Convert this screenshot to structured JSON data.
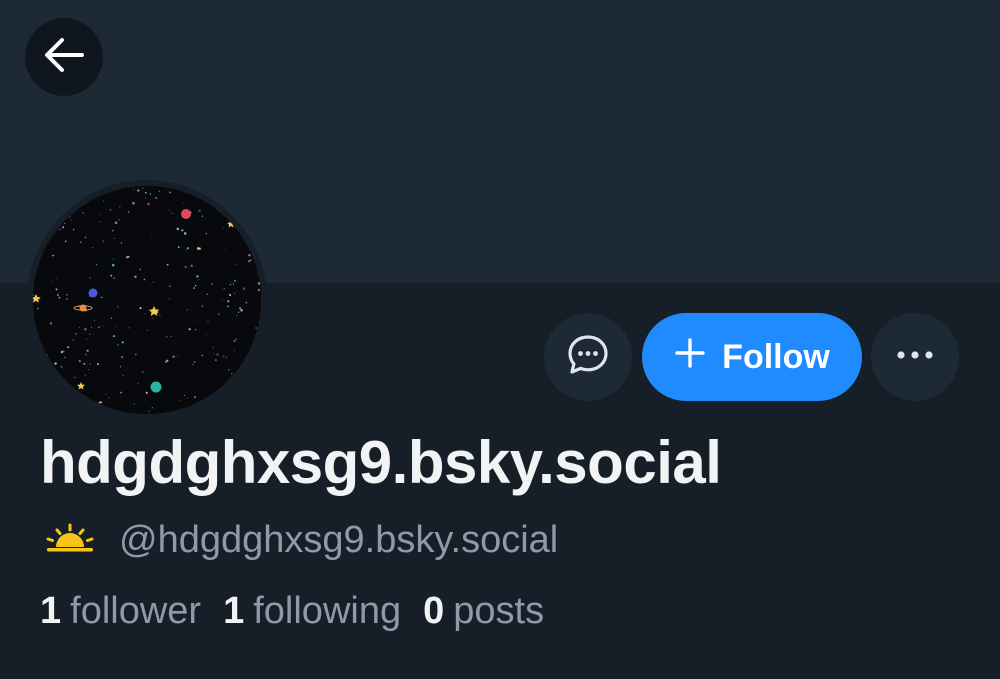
{
  "profile": {
    "display_name": "hdgdghxsg9.bsky.social",
    "handle": "@hdgdghxsg9.bsky.social",
    "status_icon": "sunrise-icon"
  },
  "actions": {
    "follow_label": "Follow",
    "message_icon": "chat-bubble-icon",
    "more_icon": "ellipsis-icon",
    "back_icon": "arrow-left-icon"
  },
  "stats": {
    "followers_count": "1",
    "followers_label": "follower",
    "following_count": "1",
    "following_label": "following",
    "posts_count": "0",
    "posts_label": "posts"
  },
  "colors": {
    "background": "#161e27",
    "banner": "#1e2936",
    "accent": "#208bfe",
    "text_primary": "#f1f3f5",
    "text_secondary": "#8d9aaa",
    "sun": "#f5c518"
  }
}
